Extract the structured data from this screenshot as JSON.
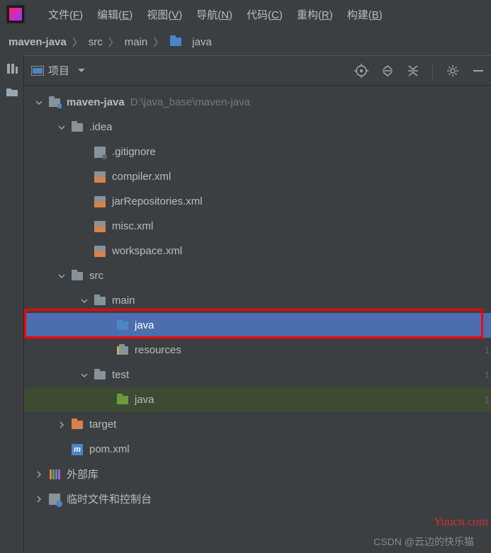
{
  "menubar": {
    "items": [
      {
        "label": "文件",
        "key": "F"
      },
      {
        "label": "编辑",
        "key": "E"
      },
      {
        "label": "视图",
        "key": "V"
      },
      {
        "label": "导航",
        "key": "N"
      },
      {
        "label": "代码",
        "key": "C"
      },
      {
        "label": "重构",
        "key": "R"
      },
      {
        "label": "构建",
        "key": "B"
      }
    ]
  },
  "breadcrumb": {
    "items": [
      "maven-java",
      "src",
      "main",
      "java"
    ]
  },
  "toolwindow": {
    "title": "项目"
  },
  "tree": {
    "project_name": "maven-java",
    "project_path": "D:\\java_base\\maven-java",
    "idea_folder": ".idea",
    "files": {
      "gitignore": ".gitignore",
      "compiler": "compiler.xml",
      "jarrepo": "jarRepositories.xml",
      "misc": "misc.xml",
      "workspace": "workspace.xml"
    },
    "src": "src",
    "main": "main",
    "java": "java",
    "resources": "resources",
    "test": "test",
    "test_java": "java",
    "target": "target",
    "pom": "pom.xml",
    "ext_lib": "外部库",
    "scratch": "临时文件和控制台"
  },
  "gutter": [
    "1",
    "1",
    "1"
  ],
  "watermark_right": "Yuucn.com",
  "watermark_bottom": "CSDN @云边的快乐猫"
}
